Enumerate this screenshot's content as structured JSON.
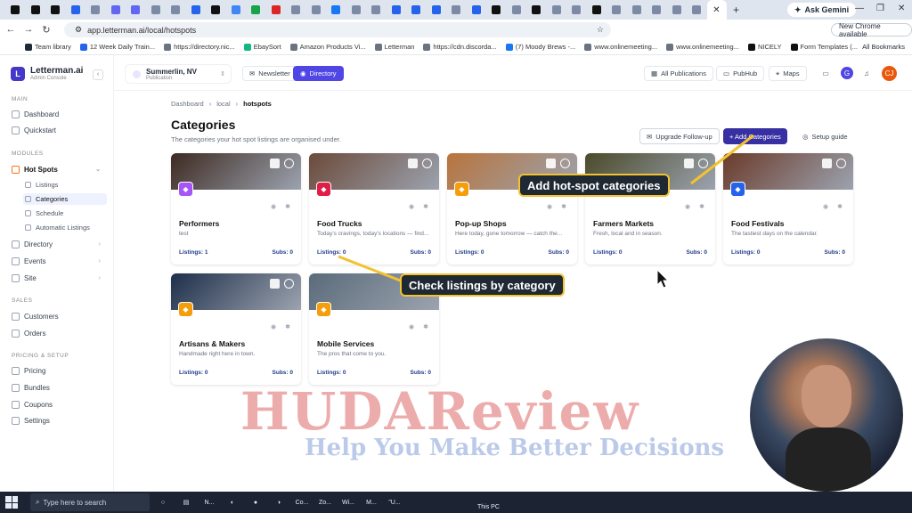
{
  "browser": {
    "tab_close": "✕",
    "new_tab": "+",
    "ask_gemini": "Ask Gemini",
    "url": "app.letterman.ai/local/hotspots",
    "new_chrome": "New Chrome available",
    "bookmarks": [
      {
        "label": "Team library",
        "color": "#1f2937"
      },
      {
        "label": "12 Week Daily Train...",
        "color": "#2563eb"
      },
      {
        "label": "https://directory.nic...",
        "color": "#6b7280"
      },
      {
        "label": "EbaySort",
        "color": "#10b981"
      },
      {
        "label": "Amazon Products Vi...",
        "color": "#6b7280"
      },
      {
        "label": "Letterman",
        "color": "#6b7280"
      },
      {
        "label": "https://cdn.discorda...",
        "color": "#6b7280"
      },
      {
        "label": "(7) Moody Brews -...",
        "color": "#1877f2"
      },
      {
        "label": "www.onlinemeeting...",
        "color": "#6b7280"
      },
      {
        "label": "www.onlinemeeting...",
        "color": "#6b7280"
      },
      {
        "label": "NICELY",
        "color": "#111"
      },
      {
        "label": "Form Templates (...",
        "color": "#111"
      }
    ],
    "all_bookmarks": "All Bookmarks"
  },
  "sidebar": {
    "brand": "Letterman.ai",
    "brand_sub": "Admin Console",
    "collapse": "‹",
    "main_label": "MAIN",
    "modules_label": "MODULES",
    "sales_label": "SALES",
    "pricing_label": "PRICING & SETUP",
    "main": [
      "Dashboard",
      "Quickstart"
    ],
    "hot_spots": "Hot Spots",
    "hot_sub": [
      "Listings",
      "Categories",
      "Schedule",
      "Automatic Listings"
    ],
    "modules": [
      "Directory",
      "Events",
      "Site"
    ],
    "sales": [
      "Customers",
      "Orders"
    ],
    "pricing": [
      "Pricing",
      "Bundles",
      "Coupons",
      "Settings"
    ]
  },
  "topbar": {
    "pub_name": "Summerlin, NV",
    "pub_sub": "Publication",
    "newsletter": "Newsletter",
    "directory": "Directory",
    "all_publications": "All Publications",
    "pubhub": "PubHub",
    "maps": "Maps",
    "avatar_g": "G",
    "avatar_cj": "CJ"
  },
  "page": {
    "crumbs": [
      "Dashboard",
      "local",
      "hotspots"
    ],
    "title": "Categories",
    "subtitle": "The categories your hot spot listings are organised under.",
    "upgrade": "Upgrade Follow-up",
    "add": "+ Add Categories",
    "setup": "Setup guide"
  },
  "cards": [
    {
      "name": "Performers",
      "desc": "test",
      "listings": "Listings: 1",
      "subs": "Subs: 0",
      "badge": "#a855f7",
      "img": "#3d2a22"
    },
    {
      "name": "Food Trucks",
      "desc": "Today's cravings, today's locations — find...",
      "listings": "Listings: 0",
      "subs": "Subs: 0",
      "badge": "#e11d48",
      "img": "#6b4a3a"
    },
    {
      "name": "Pop-up Shops",
      "desc": "Here today, gone tomorrow — catch the...",
      "listings": "Listings: 0",
      "subs": "Subs: 0",
      "badge": "#f59e0b",
      "img": "#b8743d"
    },
    {
      "name": "Farmers Markets",
      "desc": "Fresh, local and in season.",
      "listings": "Listings: 0",
      "subs": "Subs: 0",
      "badge": "#f59e0b",
      "img": "#4a4a2a"
    },
    {
      "name": "Food Festivals",
      "desc": "The tastiest days on the calendar.",
      "listings": "Listings: 0",
      "subs": "Subs: 0",
      "badge": "#2563eb",
      "img": "#6b3a2a"
    },
    {
      "name": "Artisans & Makers",
      "desc": "Handmade right here in town.",
      "listings": "Listings: 0",
      "subs": "Subs: 0",
      "badge": "#f59e0b",
      "img": "#1e2f4a"
    },
    {
      "name": "Mobile Services",
      "desc": "The pros that come to you.",
      "listings": "Listings: 0",
      "subs": "Subs: 0",
      "badge": "#f59e0b",
      "img": "#5a6b7a"
    }
  ],
  "callouts": {
    "add": "Add hot-spot categories",
    "check": "Check listings by category"
  },
  "watermark": {
    "main": "HUDAReview",
    "tag": "Help You Make Better Decisions"
  },
  "taskbar": {
    "search": "Type here to search",
    "items": [
      "N...",
      "Co...",
      "Zo...",
      "Wi...",
      "M...",
      "\"U...",
      "This PC"
    ]
  }
}
